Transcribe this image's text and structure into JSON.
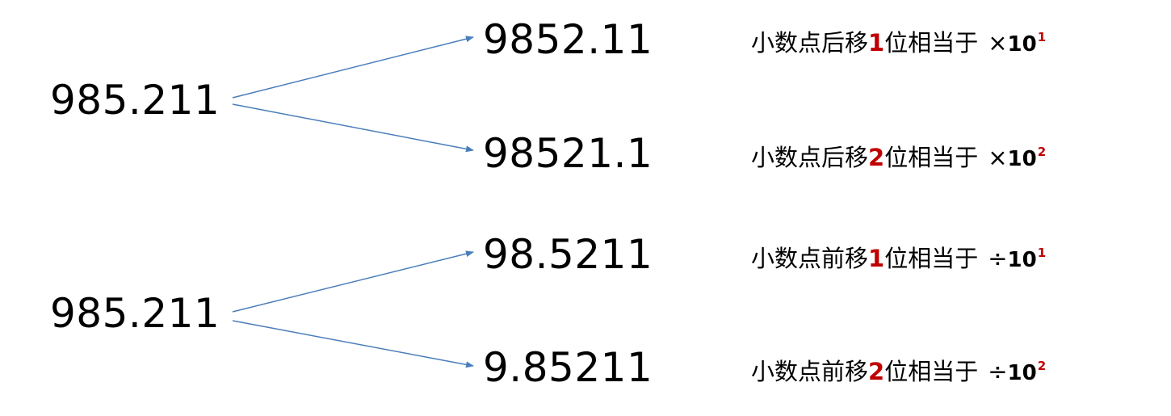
{
  "colors": {
    "arrow": "#4a7ebb",
    "highlight": "#c00000",
    "text": "#000000"
  },
  "groups": [
    {
      "source": "985.211",
      "rows": [
        {
          "result": "9852.11",
          "rule": {
            "prefix": "小数点后移",
            "digits": "1",
            "suffix": "位相当于",
            "operator": "×",
            "base": "10",
            "exponent": "1"
          }
        },
        {
          "result": "98521.1",
          "rule": {
            "prefix": "小数点后移",
            "digits": "2",
            "suffix": "位相当于",
            "operator": "×",
            "base": "10",
            "exponent": "2"
          }
        }
      ]
    },
    {
      "source": "985.211",
      "rows": [
        {
          "result": "98.5211",
          "rule": {
            "prefix": "小数点前移",
            "digits": "1",
            "suffix": "位相当于",
            "operator": "÷",
            "base": "10",
            "exponent": "1"
          }
        },
        {
          "result": "9.85211",
          "rule": {
            "prefix": "小数点前移",
            "digits": "2",
            "suffix": "位相当于",
            "operator": "÷",
            "base": "10",
            "exponent": "2"
          }
        }
      ]
    }
  ]
}
